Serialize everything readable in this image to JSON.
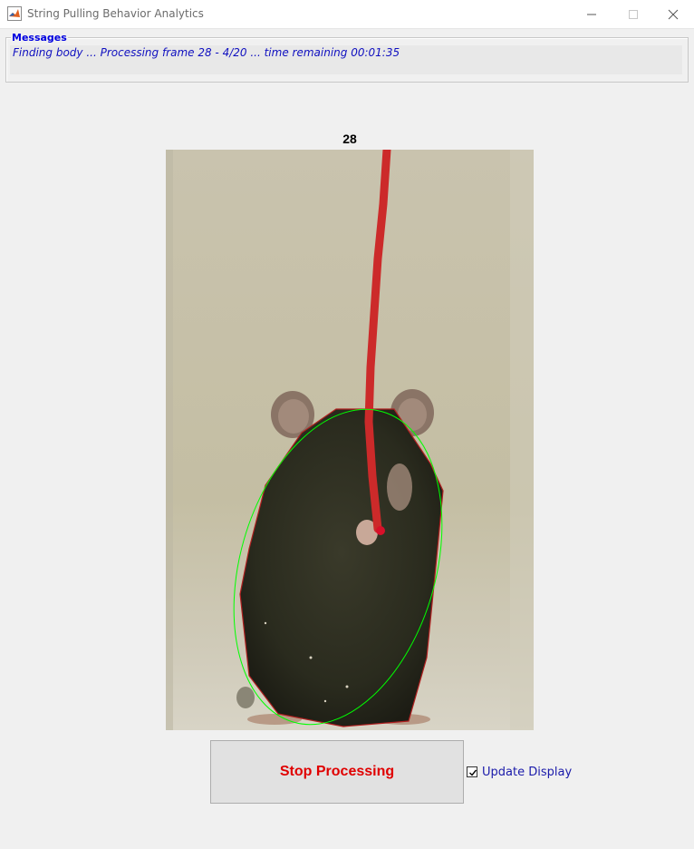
{
  "window": {
    "title": "String Pulling Behavior Analytics",
    "icon": "matlab-icon",
    "controls": [
      "minimize-icon",
      "maximize-icon",
      "close-icon"
    ]
  },
  "messages": {
    "legend": "Messages",
    "text": "Finding body ... Processing frame 28 - 4/20 ... time remaining 00:01:35"
  },
  "display": {
    "frame_number": "28",
    "image_description_icon": "mouse-frame-image"
  },
  "controls": {
    "stop_button_label": "Stop Processing",
    "update_display_label": "Update Display",
    "update_display_checked": true
  },
  "colors": {
    "legend": "#0000e0",
    "message_text": "#1010c0",
    "stop_label": "#e00000",
    "body_outline": "#00ff00",
    "string": "#cc2a2a"
  }
}
